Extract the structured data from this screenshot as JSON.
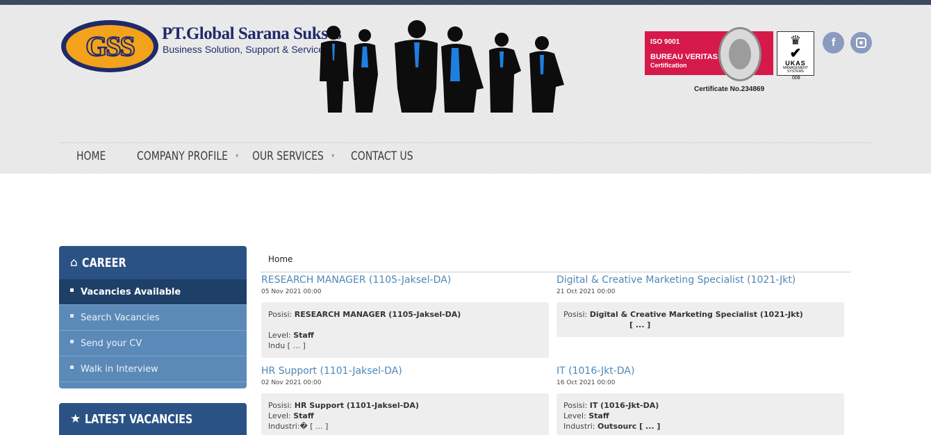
{
  "brand": {
    "logo_text": "GSS",
    "name": "PT.Global Sarana Sukses",
    "tagline": "Business Solution, Support & Services"
  },
  "certification": {
    "iso_line1": "ISO 9001",
    "iso_line2": "BUREAU VERITAS",
    "iso_line3": "Certification",
    "ukas_title": "UKAS",
    "ukas_sub": "MANAGEMENT SYSTEMS",
    "ukas_number": "008",
    "certificate_text": "Certificate No.234869"
  },
  "social": {
    "facebook_glyph": "f"
  },
  "nav": [
    {
      "label": "HOME",
      "has_dropdown": false
    },
    {
      "label": "COMPANY PROFILE",
      "has_dropdown": true
    },
    {
      "label": "OUR SERVICES",
      "has_dropdown": true
    },
    {
      "label": "CONTACT US",
      "has_dropdown": false
    }
  ],
  "sidebar": {
    "career_title": "CAREER",
    "career_items": [
      {
        "label": "Vacancies Available",
        "active": true
      },
      {
        "label": "Search Vacancies",
        "active": false
      },
      {
        "label": "Send your CV",
        "active": false
      },
      {
        "label": "Walk in Interview",
        "active": false
      }
    ],
    "latest_title": "LATEST VACANCIES"
  },
  "breadcrumb": "Home",
  "jobs": [
    {
      "title": "RESEARCH MANAGER (1105-Jaksel-DA)",
      "date": "05 Nov 2021 00:00",
      "lines": [
        {
          "label": "Posisi: ",
          "value": "RESEARCH MANAGER (1105-Jaksel-DA)"
        },
        {
          "label": "",
          "value": ""
        },
        {
          "label": "Level: ",
          "value": "Staff"
        },
        {
          "label": "Indu [ ... ]",
          "value": ""
        }
      ]
    },
    {
      "title": "Digital & Creative Marketing Specialist (1021-Jkt)",
      "date": "21 Oct 2021 00:00",
      "lines": [
        {
          "label": "Posisi: ",
          "value": "Digital & Creative Marketing Specialist (1021-Jkt)"
        },
        {
          "label": "",
          "value": "[ ... ]",
          "indent": true
        }
      ]
    },
    {
      "title": "HR Support (1101-Jaksel-DA)",
      "date": "02 Nov 2021 00:00",
      "lines": [
        {
          "label": "Posisi: ",
          "value": "HR Support (1101-Jaksel-DA)"
        },
        {
          "label": "Level: ",
          "value": "Staff"
        },
        {
          "label": "Industri:� [ ... ]",
          "value": ""
        }
      ]
    },
    {
      "title": "IT (1016-Jkt-DA)",
      "date": "16 Oct 2021 00:00",
      "lines": [
        {
          "label": "Posisi: ",
          "value": "IT (1016-Jkt-DA)"
        },
        {
          "label": "Level: ",
          "value": "Staff"
        },
        {
          "label": "Industri:  ",
          "value": "Outsourc [ ... ]"
        }
      ]
    }
  ],
  "colors": {
    "top_bar": "#3b4a5e",
    "sidebar_header": "#2b5285",
    "sidebar_item": "#5b8ab8",
    "sidebar_active": "#1e3f66",
    "job_title": "#4f87b8",
    "iso_red": "#d6194b"
  }
}
